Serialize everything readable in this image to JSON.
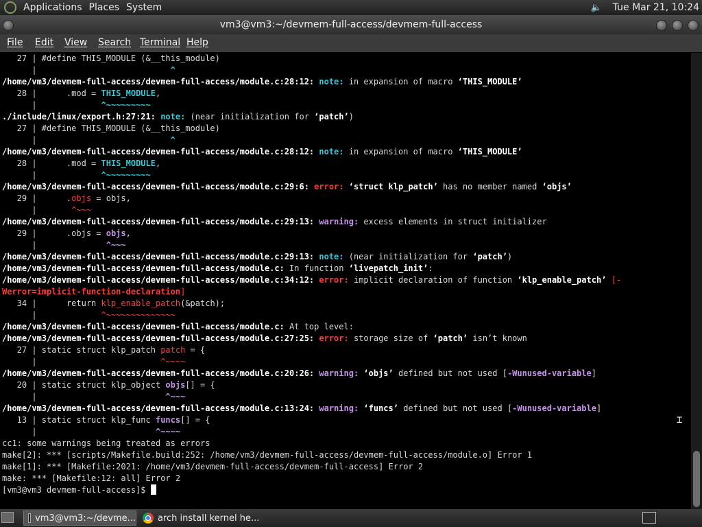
{
  "topbar": {
    "menus": [
      "Applications",
      "Places",
      "System"
    ],
    "datetime": "Tue Mar 21, 10:24",
    "volume_icon": "speaker-icon"
  },
  "window": {
    "title": "vm3@vm3:~/devmem-full-access/devmem-full-access"
  },
  "menubar": [
    "File",
    "Edit",
    "View",
    "Search",
    "Terminal",
    "Help"
  ],
  "terminal": {
    "colors": {
      "note": "#36c8d8",
      "error": "#ff3b3b",
      "warning": "#c792ea"
    },
    "lines": [
      [
        {
          "t": "   27 | #define THIS_MODULE (&__this_module)",
          "c": ""
        }
      ],
      [
        {
          "t": "      |                           ",
          "c": ""
        },
        {
          "t": "^",
          "c": "cyanhl"
        }
      ],
      [
        {
          "t": "/home/vm3/devmem-full-access/devmem-full-access/module.c:28:12: ",
          "c": "b"
        },
        {
          "t": "note:",
          "c": "note"
        },
        {
          "t": " in expansion of macro ",
          "c": ""
        },
        {
          "t": "‘THIS_MODULE’",
          "c": "b"
        }
      ],
      [
        {
          "t": "   28 |      .mod = ",
          "c": ""
        },
        {
          "t": "THIS_MODULE",
          "c": "cyanhl"
        },
        {
          "t": ",",
          "c": ""
        }
      ],
      [
        {
          "t": "      |             ",
          "c": ""
        },
        {
          "t": "^~~~~~~~~~",
          "c": "cyanhl"
        }
      ],
      [
        {
          "t": "./include/linux/export.h:27:21: ",
          "c": "b"
        },
        {
          "t": "note:",
          "c": "note"
        },
        {
          "t": " (near initialization for ",
          "c": ""
        },
        {
          "t": "‘patch’",
          "c": "b"
        },
        {
          "t": ")",
          "c": ""
        }
      ],
      [
        {
          "t": "   27 | #define THIS_MODULE (&__this_module)",
          "c": ""
        }
      ],
      [
        {
          "t": "      |                           ",
          "c": ""
        },
        {
          "t": "^",
          "c": "cyanhl"
        }
      ],
      [
        {
          "t": "/home/vm3/devmem-full-access/devmem-full-access/module.c:28:12: ",
          "c": "b"
        },
        {
          "t": "note:",
          "c": "note"
        },
        {
          "t": " in expansion of macro ",
          "c": ""
        },
        {
          "t": "‘THIS_MODULE’",
          "c": "b"
        }
      ],
      [
        {
          "t": "   28 |      .mod = ",
          "c": ""
        },
        {
          "t": "THIS_MODULE",
          "c": "cyanhl"
        },
        {
          "t": ",",
          "c": ""
        }
      ],
      [
        {
          "t": "      |             ",
          "c": ""
        },
        {
          "t": "^~~~~~~~~~",
          "c": "cyanhl"
        }
      ],
      [
        {
          "t": "/home/vm3/devmem-full-access/devmem-full-access/module.c:29:6: ",
          "c": "b"
        },
        {
          "t": "error:",
          "c": "err"
        },
        {
          "t": " ",
          "c": ""
        },
        {
          "t": "‘struct klp_patch’",
          "c": "b"
        },
        {
          "t": " has no member named ",
          "c": ""
        },
        {
          "t": "‘objs’",
          "c": "b"
        }
      ],
      [
        {
          "t": "   29 |      .",
          "c": ""
        },
        {
          "t": "objs",
          "c": "redhl"
        },
        {
          "t": " = objs,",
          "c": ""
        }
      ],
      [
        {
          "t": "      |       ",
          "c": ""
        },
        {
          "t": "^~~~",
          "c": "redhl"
        }
      ],
      [
        {
          "t": "/home/vm3/devmem-full-access/devmem-full-access/module.c:29:13: ",
          "c": "b"
        },
        {
          "t": "warning:",
          "c": "warn"
        },
        {
          "t": " excess elements in struct initializer",
          "c": ""
        }
      ],
      [
        {
          "t": "   29 |      .objs = ",
          "c": ""
        },
        {
          "t": "objs",
          "c": "warn"
        },
        {
          "t": ",",
          "c": ""
        }
      ],
      [
        {
          "t": "      |              ",
          "c": ""
        },
        {
          "t": "^~~~",
          "c": "warn"
        }
      ],
      [
        {
          "t": "/home/vm3/devmem-full-access/devmem-full-access/module.c:29:13: ",
          "c": "b"
        },
        {
          "t": "note:",
          "c": "note"
        },
        {
          "t": " (near initialization for ",
          "c": ""
        },
        {
          "t": "‘patch’",
          "c": "b"
        },
        {
          "t": ")",
          "c": ""
        }
      ],
      [
        {
          "t": "/home/vm3/devmem-full-access/devmem-full-access/module.c:",
          "c": "b"
        },
        {
          "t": " In function ",
          "c": ""
        },
        {
          "t": "‘livepatch_init’",
          "c": "b"
        },
        {
          "t": ":",
          "c": ""
        }
      ],
      [
        {
          "t": "/home/vm3/devmem-full-access/devmem-full-access/module.c:34:12: ",
          "c": "b"
        },
        {
          "t": "error:",
          "c": "err"
        },
        {
          "t": " implicit declaration of function ",
          "c": ""
        },
        {
          "t": "‘klp_enable_patch’",
          "c": "b"
        },
        {
          "t": " [-",
          "c": "redhl"
        }
      ],
      [
        {
          "t": "Werror=implicit-function-declaration",
          "c": "err"
        },
        {
          "t": "]",
          "c": "redhl"
        }
      ],
      [
        {
          "t": "   34 |      return ",
          "c": ""
        },
        {
          "t": "klp_enable_patch",
          "c": "redhl"
        },
        {
          "t": "(&patch);",
          "c": ""
        }
      ],
      [
        {
          "t": "      |             ",
          "c": ""
        },
        {
          "t": "^~~~~~~~~~~~~~~",
          "c": "redhl"
        }
      ],
      [
        {
          "t": "/home/vm3/devmem-full-access/devmem-full-access/module.c:",
          "c": "b"
        },
        {
          "t": " At top level:",
          "c": ""
        }
      ],
      [
        {
          "t": "/home/vm3/devmem-full-access/devmem-full-access/module.c:27:25: ",
          "c": "b"
        },
        {
          "t": "error:",
          "c": "err"
        },
        {
          "t": " storage size of ",
          "c": ""
        },
        {
          "t": "‘patch’",
          "c": "b"
        },
        {
          "t": " isn’t known",
          "c": ""
        }
      ],
      [
        {
          "t": "   27 | static struct klp_patch ",
          "c": ""
        },
        {
          "t": "patch",
          "c": "redhl"
        },
        {
          "t": " = {",
          "c": ""
        }
      ],
      [
        {
          "t": "      |                         ",
          "c": ""
        },
        {
          "t": "^~~~~",
          "c": "redhl"
        }
      ],
      [
        {
          "t": "/home/vm3/devmem-full-access/devmem-full-access/module.c:20:26: ",
          "c": "b"
        },
        {
          "t": "warning:",
          "c": "warn"
        },
        {
          "t": " ",
          "c": ""
        },
        {
          "t": "‘objs’",
          "c": "b"
        },
        {
          "t": " defined but not used [",
          "c": ""
        },
        {
          "t": "-Wunused-variable",
          "c": "warn"
        },
        {
          "t": "]",
          "c": ""
        }
      ],
      [
        {
          "t": "   20 | static struct klp_object ",
          "c": ""
        },
        {
          "t": "objs",
          "c": "warn"
        },
        {
          "t": "[] = {",
          "c": ""
        }
      ],
      [
        {
          "t": "      |                          ",
          "c": ""
        },
        {
          "t": "^~~~",
          "c": "warn"
        }
      ],
      [
        {
          "t": "/home/vm3/devmem-full-access/devmem-full-access/module.c:13:24: ",
          "c": "b"
        },
        {
          "t": "warning:",
          "c": "warn"
        },
        {
          "t": " ",
          "c": ""
        },
        {
          "t": "‘funcs’",
          "c": "b"
        },
        {
          "t": " defined but not used [",
          "c": ""
        },
        {
          "t": "-Wunused-variable",
          "c": "warn"
        },
        {
          "t": "]",
          "c": ""
        }
      ],
      [
        {
          "t": "   13 | static struct klp_func ",
          "c": ""
        },
        {
          "t": "funcs",
          "c": "warn"
        },
        {
          "t": "[] = {",
          "c": ""
        }
      ],
      [
        {
          "t": "      |                        ",
          "c": ""
        },
        {
          "t": "^~~~~",
          "c": "warn"
        }
      ],
      [
        {
          "t": "cc1: some warnings being treated as errors",
          "c": ""
        }
      ],
      [
        {
          "t": "make[2]: *** [scripts/Makefile.build:252: /home/vm3/devmem-full-access/devmem-full-access/module.o] Error 1",
          "c": ""
        }
      ],
      [
        {
          "t": "make[1]: *** [Makefile:2021: /home/vm3/devmem-full-access/devmem-full-access] Error 2",
          "c": ""
        }
      ],
      [
        {
          "t": "make: *** [Makefile:12: all] Error 2",
          "c": ""
        }
      ],
      [
        {
          "t": "[vm3@vm3 devmem-full-access]$ ",
          "c": ""
        }
      ]
    ]
  },
  "taskbar": {
    "tasks": [
      {
        "label": "vm3@vm3:~/devme...",
        "icon": "terminal-icon",
        "active": true
      },
      {
        "label": "arch install kernel he...",
        "icon": "chrome-icon",
        "active": false
      }
    ]
  }
}
